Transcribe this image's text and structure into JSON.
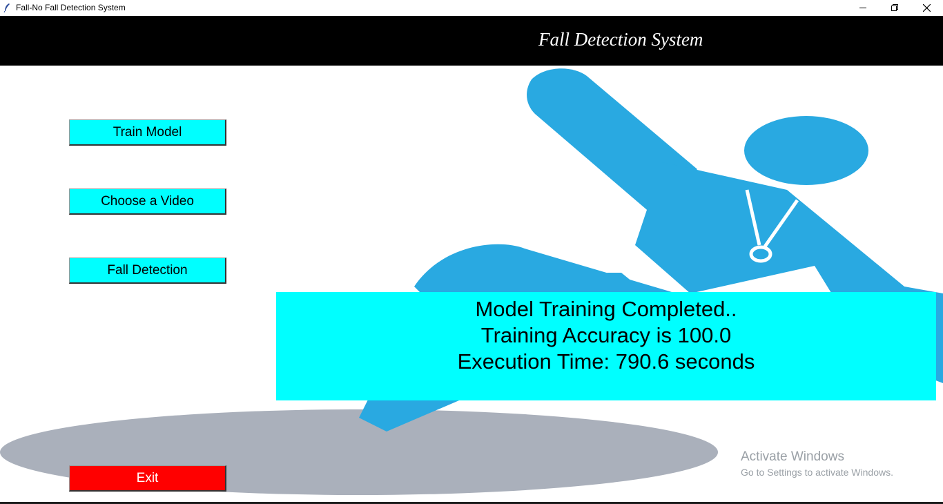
{
  "window": {
    "title": "Fall-No Fall Detection System",
    "controls": [
      "minimize-icon",
      "restore-icon",
      "close-icon"
    ]
  },
  "header": {
    "title": "Fall Detection System"
  },
  "sidebar": {
    "buttons": [
      {
        "label": "Train Model"
      },
      {
        "label": "Choose a Video"
      },
      {
        "label": "Fall Detection"
      }
    ],
    "exit_label": "Exit"
  },
  "result": {
    "line1": "Model Training Completed..",
    "line2": "Training Accuracy is 100.0",
    "line3": "Execution Time: 790.6 seconds"
  },
  "watermark": {
    "title": "Activate Windows",
    "subtitle": "Go to Settings to activate Windows."
  },
  "colors": {
    "header_bg": "#000000",
    "button_bg": "#00ffff",
    "exit_bg": "#ff0000",
    "result_bg": "#00ffff",
    "figure": "#29a9e1",
    "floor": "#aab0bb"
  }
}
